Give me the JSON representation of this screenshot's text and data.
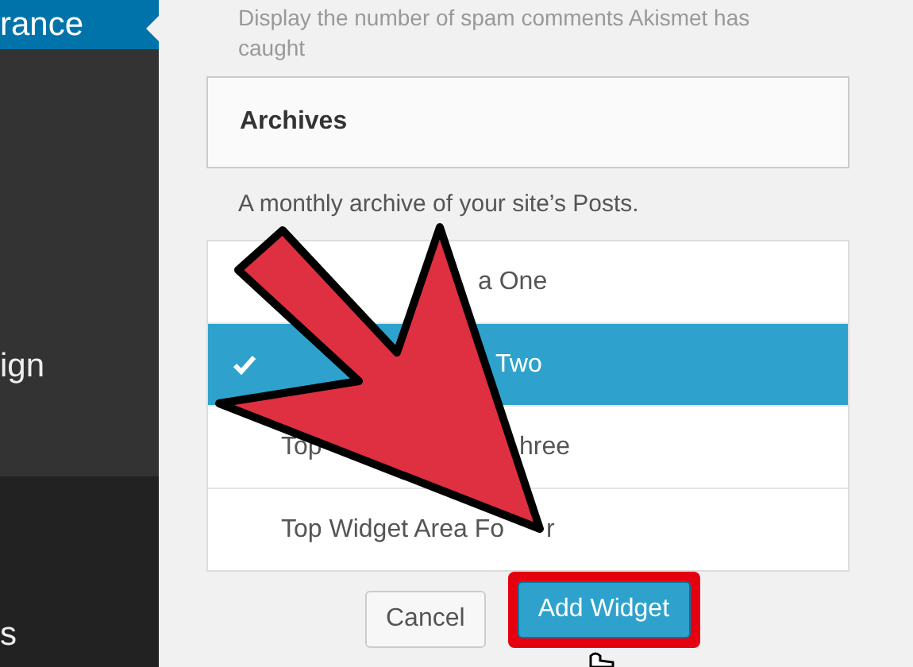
{
  "sidebar": {
    "items": [
      {
        "label": "rance",
        "selected": true
      },
      {
        "label": "ign",
        "selected": false
      },
      {
        "label": "s",
        "selected": false
      }
    ]
  },
  "previous_widget": {
    "description": "Display the number of spam comments Akismet has caught"
  },
  "widget": {
    "title": "Archives",
    "description": "A monthly archive of your site’s Posts."
  },
  "widget_areas": [
    {
      "text_right": "a One",
      "selected": false
    },
    {
      "text_right": "Two",
      "selected": true
    },
    {
      "text_left": "Top",
      "text_right": "hree",
      "selected": false
    },
    {
      "text_left": "Top Widget Area Fo",
      "text_right": "r",
      "selected": false
    }
  ],
  "buttons": [
    {
      "label": "Cancel",
      "kind": "secondary",
      "highlighted": false
    },
    {
      "label": "Add Widget",
      "kind": "primary",
      "highlighted": true
    }
  ]
}
